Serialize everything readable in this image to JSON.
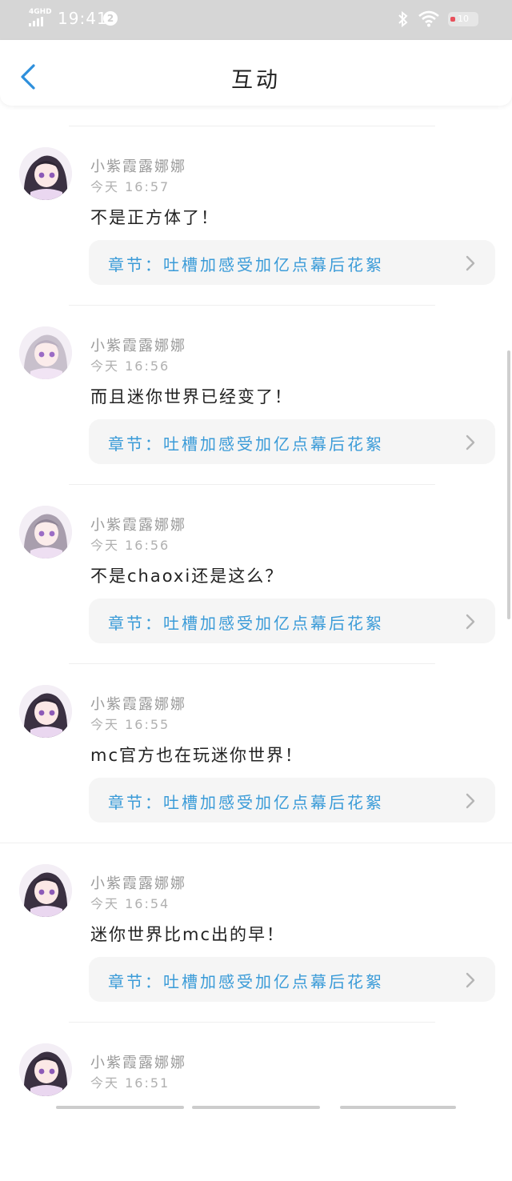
{
  "status_bar": {
    "network": "4GHD",
    "time": "19:41",
    "notification_count": "2",
    "battery": "10"
  },
  "header": {
    "title": "互动",
    "back_icon": "chevron-left-icon"
  },
  "colors": {
    "accent": "#3a9bd8",
    "card_bg": "#f5f5f5",
    "status_bar_bg": "#d6d6d6"
  },
  "comments": [
    {
      "user": "小紫霞露娜娜",
      "time": "今天 16:57",
      "content": "不是正方体了！",
      "chapter": "章节：吐槽加感受加亿点幕后花絮"
    },
    {
      "user": "小紫霞露娜娜",
      "time": "今天 16:56",
      "content": "而且迷你世界已经变了！",
      "chapter": "章节：吐槽加感受加亿点幕后花絮"
    },
    {
      "user": "小紫霞露娜娜",
      "time": "今天 16:56",
      "content": "不是chaoxi还是这么？",
      "chapter": "章节：吐槽加感受加亿点幕后花絮"
    },
    {
      "user": "小紫霞露娜娜",
      "time": "今天 16:55",
      "content": "mc官方也在玩迷你世界！",
      "chapter": "章节：吐槽加感受加亿点幕后花絮"
    },
    {
      "user": "小紫霞露娜娜",
      "time": "今天 16:54",
      "content": "迷你世界比mc出的早！",
      "chapter": "章节：吐槽加感受加亿点幕后花絮"
    },
    {
      "user": "小紫霞露娜娜",
      "time": "今天 16:51",
      "content": "",
      "chapter": ""
    }
  ]
}
